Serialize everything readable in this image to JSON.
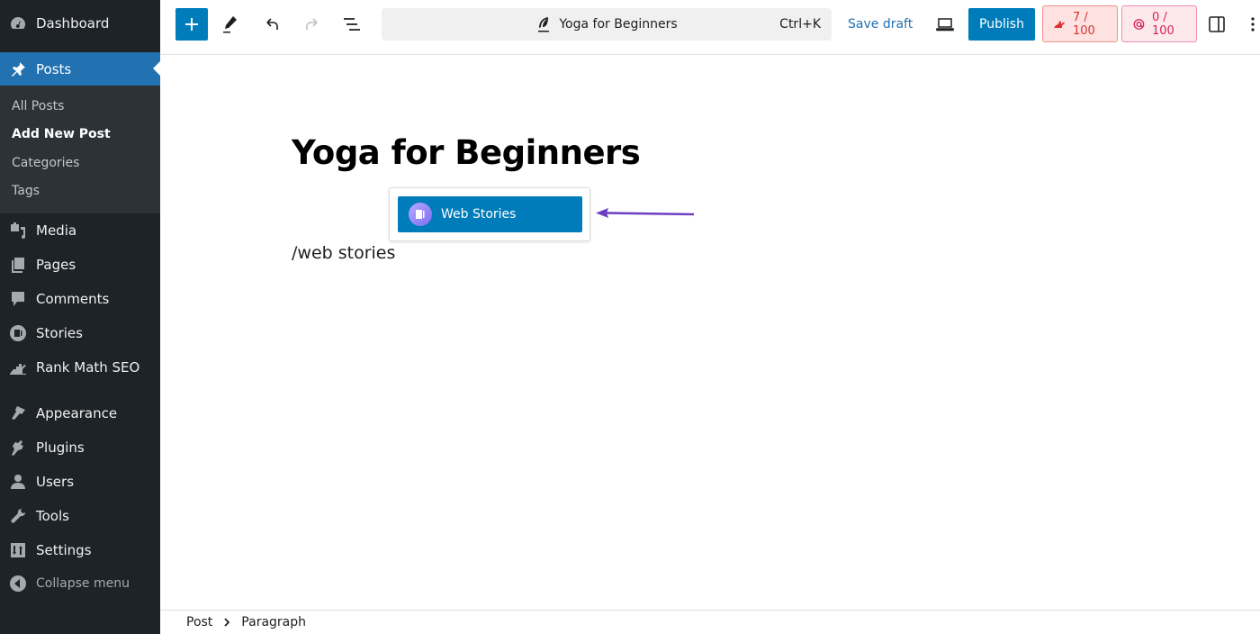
{
  "sidebar": {
    "items": [
      {
        "label": "Dashboard",
        "icon": "dashboard-icon"
      },
      {
        "label": "Posts",
        "icon": "pin-icon",
        "active": true
      },
      {
        "label": "Media",
        "icon": "media-icon"
      },
      {
        "label": "Pages",
        "icon": "pages-icon"
      },
      {
        "label": "Comments",
        "icon": "comment-icon"
      },
      {
        "label": "Stories",
        "icon": "stories-icon"
      },
      {
        "label": "Rank Math SEO",
        "icon": "rank-math-icon"
      },
      {
        "label": "Appearance",
        "icon": "paintbrush-icon"
      },
      {
        "label": "Plugins",
        "icon": "plug-icon"
      },
      {
        "label": "Users",
        "icon": "user-icon"
      },
      {
        "label": "Tools",
        "icon": "wrench-icon"
      },
      {
        "label": "Settings",
        "icon": "settings-icon"
      },
      {
        "label": "Collapse menu",
        "icon": "collapse-icon"
      }
    ],
    "submenu": [
      {
        "label": "All Posts"
      },
      {
        "label": "Add New Post",
        "current": true
      },
      {
        "label": "Categories"
      },
      {
        "label": "Tags"
      }
    ]
  },
  "toolbar": {
    "doc_title": "Yoga for Beginners",
    "shortcut": "Ctrl+K",
    "save_draft": "Save draft",
    "publish": "Publish",
    "seo_score": "7 / 100",
    "content_score": "0 / 100",
    "colors": {
      "primary": "#007cba",
      "seo": "#dc3232",
      "content": "#d6225b"
    }
  },
  "editor": {
    "title": "Yoga for Beginners",
    "paragraph": "/web stories",
    "suggestion": "Web Stories",
    "arrow_color": "#6c3fc0"
  },
  "footer": {
    "breadcrumb": [
      "Post",
      "Paragraph"
    ]
  }
}
